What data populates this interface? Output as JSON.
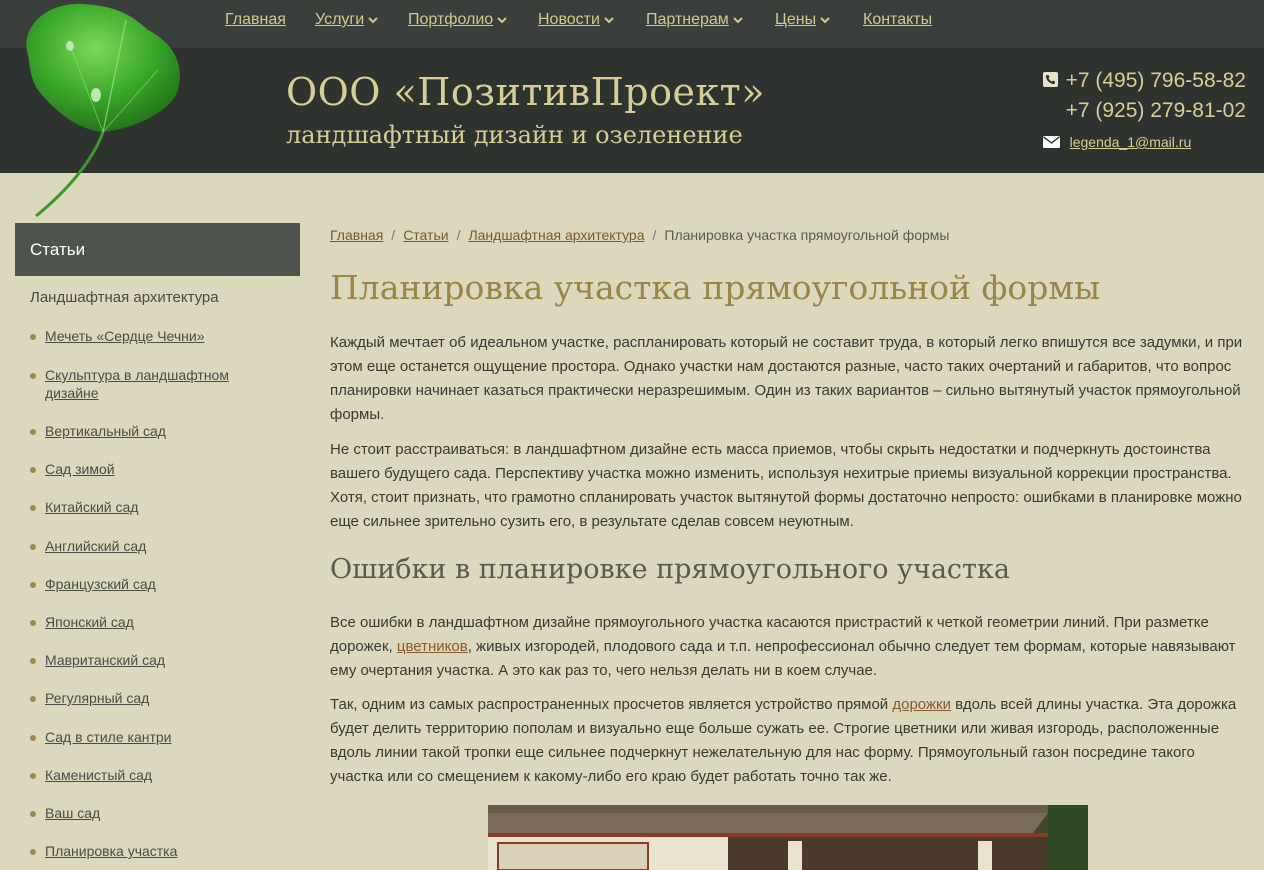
{
  "nav": {
    "items": [
      {
        "label": "Главная",
        "dropdown": false
      },
      {
        "label": "Услуги",
        "dropdown": true
      },
      {
        "label": "Портфолио",
        "dropdown": true
      },
      {
        "label": "Новости",
        "dropdown": true
      },
      {
        "label": "Партнерам",
        "dropdown": true
      },
      {
        "label": "Цены",
        "dropdown": true
      },
      {
        "label": "Контакты",
        "dropdown": false
      }
    ]
  },
  "header": {
    "title": "ООО «ПозитивПроект»",
    "subtitle": "ландшафтный дизайн и озеленение",
    "phone1": "+7 (495) 796-58-82",
    "phone2": "+7 (925) 279-81-02",
    "email": "legenda_1@mail.ru",
    "icons": {
      "phone": "phone-icon",
      "email": "envelope-icon",
      "logo": "ginkgo-leaf-logo"
    }
  },
  "sidebar": {
    "heading": "Статьи",
    "category": "Ландшафтная архитектура",
    "items": [
      "Мечеть «Сердце Чечни»",
      "Скульптура в ландшафтном дизайне",
      "Вертикальный сад",
      "Сад зимой",
      "Китайский сад",
      "Английский сад",
      "Французский сад",
      "Японский сад",
      "Мавританский сад",
      "Регулярный сад",
      "Сад в стиле кантри",
      "Каменистый сад",
      "Ваш сад",
      "Планировка участка"
    ]
  },
  "breadcrumb": {
    "links": [
      "Главная",
      "Статьи",
      "Ландшафтная архитектура"
    ],
    "separator": "/",
    "current": "Планировка участка прямоугольной формы"
  },
  "article": {
    "title": "Планировка участка прямоугольной формы",
    "p1": "Каждый мечтает об идеальном участке, распланировать который не составит труда, в который легко впишутся все задумки, и при этом еще останется ощущение простора. Однако участки нам достаются разные, часто таких очертаний и габаритов, что вопрос планировки начинает казаться практически неразрешимым. Один из таких вариантов – сильно вытянутый участок прямоугольной формы.",
    "p2": "Не стоит расстраиваться: в ландшафтном дизайне есть масса приемов, чтобы скрыть недостатки и подчеркнуть достоинства вашего будущего сада. Перспективу участка можно изменить, используя нехитрые приемы визуальной коррекции пространства. Хотя, стоит признать, что грамотно спланировать участок вытянутой формы достаточно непросто: ошибками в планировке можно еще сильнее зрительно сузить его, в результате сделав совсем неуютным.",
    "section_title": "Ошибки в планировке прямоугольного участка",
    "p3_a": "Все ошибки в ландшафтном дизайне прямоугольного участка касаются пристрастий к четкой геометрии линий. При разметке дорожек, ",
    "p3_link": "цветников",
    "p3_b": ", живых изгородей, плодового сада и т.п. непрофессионал обычно следует тем формам, которые навязывают ему очертания участка. А это как раз то, чего нельзя делать ни в коем случае.",
    "p4_a": "Так, одним из самых распространенных просчетов является устройство прямой ",
    "p4_link": "дорожки",
    "p4_b": " вдоль всей длины участка. Эта дорожка будет делить территорию пополам и визуально еще больше сужать ее. Строгие цветники или живая изгородь, расположенные вдоль линии такой тропки еще сильнее подчеркнут нежелательную для нас форму. Прямоугольный газон посредине такого участка или со смещением к какому-либо его краю будет работать точно так же."
  },
  "colors": {
    "page_bg": "#dcd8bd",
    "nav_bg": "#3b3f3b",
    "header_bg": "#2f332f",
    "accent_gold": "#d8cd94",
    "title_gold": "#9a8446",
    "sidebar_head_bg": "#4f534e",
    "link_brown": "#8a5a2a"
  }
}
